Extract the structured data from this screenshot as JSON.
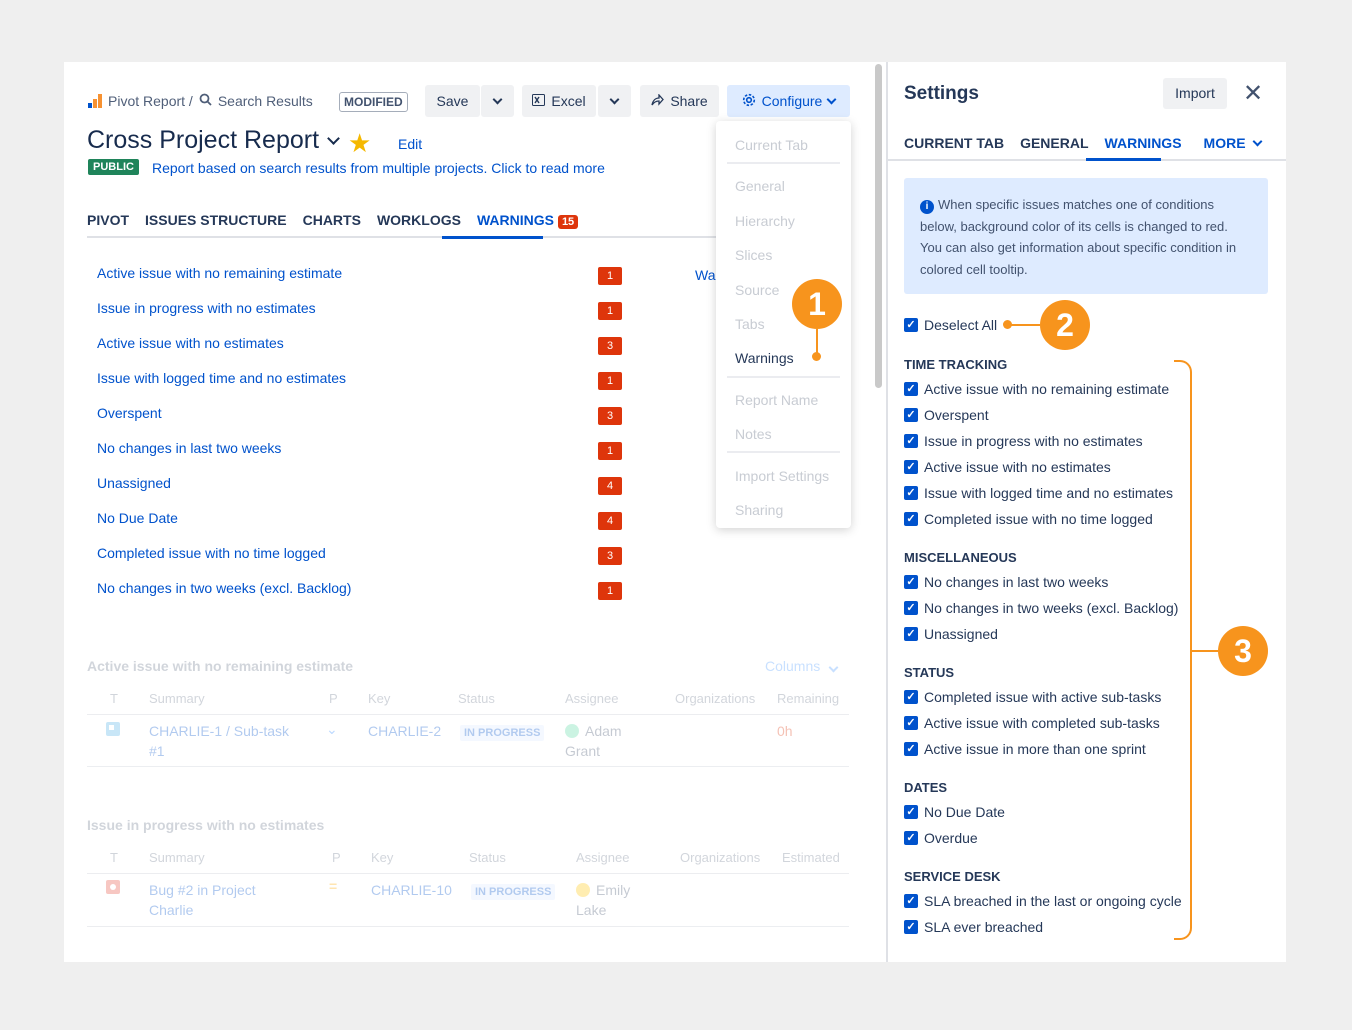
{
  "breadcrumb": {
    "part1": "Pivot Report /",
    "part2": "Search Results"
  },
  "modified_badge": "MODIFIED",
  "toolbar": {
    "save": "Save",
    "excel": "Excel",
    "share": "Share",
    "configure": "Configure"
  },
  "report": {
    "title": "Cross Project Report",
    "edit": "Edit",
    "public_badge": "PUBLIC",
    "description": "Report based on search results from multiple projects. Click to read more"
  },
  "tabs": [
    "PIVOT",
    "ISSUES STRUCTURE",
    "CHARTS",
    "WORKLOGS",
    "WARNINGS"
  ],
  "warnings_count": "15",
  "warnings": [
    {
      "label": "Active issue with no remaining estimate",
      "count": "1"
    },
    {
      "label": "Issue in progress with no estimates",
      "count": "1"
    },
    {
      "label": "Active issue with no estimates",
      "count": "3"
    },
    {
      "label": "Issue with logged time and no estimates",
      "count": "1"
    },
    {
      "label": "Overspent",
      "count": "3"
    },
    {
      "label": "No changes in last two weeks",
      "count": "1"
    },
    {
      "label": "Unassigned",
      "count": "4"
    },
    {
      "label": "No Due Date",
      "count": "4"
    },
    {
      "label": "Completed issue with no time logged",
      "count": "3"
    },
    {
      "label": "No changes in two weeks (excl. Backlog)",
      "count": "1"
    }
  ],
  "wa_cut": "Wa",
  "config_menu": {
    "current_tab": "Current Tab",
    "general": "General",
    "hierarchy": "Hierarchy",
    "slices": "Slices",
    "source": "Source",
    "tabs": "Tabs",
    "warnings": "Warnings",
    "report_name": "Report Name",
    "notes": "Notes",
    "import_settings": "Import Settings",
    "sharing": "Sharing"
  },
  "section1": {
    "heading": "Active issue with no remaining estimate",
    "columns": "Columns",
    "headers": [
      "T",
      "Summary",
      "P",
      "Key",
      "Status",
      "Assignee",
      "Organizations",
      "Remaining"
    ],
    "row": {
      "summary1": "CHARLIE-1 /  Sub-task",
      "summary2": "#1",
      "key": "CHARLIE-2",
      "status": "IN PROGRESS",
      "assignee1": "Adam",
      "assignee2": "Grant",
      "remaining": "0h"
    }
  },
  "section2": {
    "heading": "Issue in progress with no estimates",
    "headers": [
      "T",
      "Summary",
      "P",
      "Key",
      "Status",
      "Assignee",
      "Organizations",
      "Estimated"
    ],
    "row": {
      "summary1": "Bug #2 in Project",
      "summary2": "Charlie",
      "key": "CHARLIE-10",
      "status": "IN PROGRESS",
      "assignee1": "Emily",
      "assignee2": "Lake"
    }
  },
  "callouts": {
    "one": "1",
    "two": "2",
    "three": "3"
  },
  "settings": {
    "title": "Settings",
    "import": "Import",
    "tabs": {
      "current": "CURRENT TAB",
      "general": "GENERAL",
      "warnings": "WARNINGS",
      "more": "MORE"
    },
    "info_text": "When specific issues matches one of conditions below, background color of its cells is changed to red. You can also get information about specific condition in colored cell tooltip.",
    "deselect_all": "Deselect All",
    "groups": {
      "time_tracking": "TIME TRACKING",
      "misc": "MISCELLANEOUS",
      "status": "STATUS",
      "dates": "DATES",
      "service_desk": "SERVICE DESK"
    },
    "items": {
      "tt1": "Active issue with no remaining estimate",
      "tt2": "Overspent",
      "tt3": "Issue in progress with no estimates",
      "tt4": "Active issue with no estimates",
      "tt5": "Issue with logged time and no estimates",
      "tt6": "Completed issue with no time logged",
      "m1": "No changes in last two weeks",
      "m2": "No changes in two weeks (excl. Backlog)",
      "m3": "Unassigned",
      "s1": "Completed issue with active sub-tasks",
      "s2": "Active issue with completed sub-tasks",
      "s3": "Active issue in more than one sprint",
      "d1": "No Due Date",
      "d2": "Overdue",
      "sd1": "SLA breached in the last or ongoing cycle",
      "sd2": "SLA ever breached"
    }
  },
  "colors": {
    "accent": "#0052cc",
    "warning_badge": "#de350b",
    "callout": "#f7941d",
    "public_badge": "#1f845a"
  }
}
